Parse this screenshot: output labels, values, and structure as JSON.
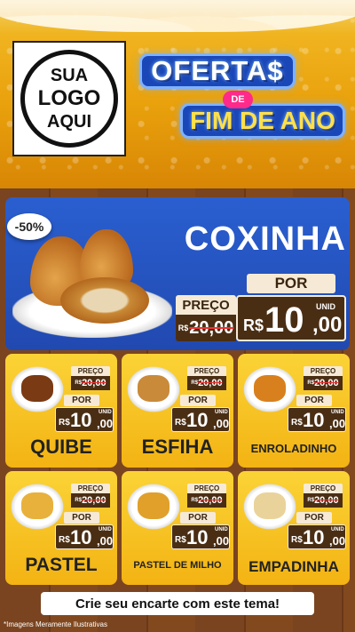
{
  "logo": {
    "line1": "SUA",
    "line2": "LOGO",
    "line3": "AQUI"
  },
  "promo": {
    "line1": "OFERTA$",
    "line2": "DE",
    "line3": "FIM DE ANO"
  },
  "hero": {
    "discount": "-50%",
    "title": "COXINHA",
    "por_label": "POR",
    "preco_label": "PREÇO",
    "old_currency": "R$",
    "old_price": "20,00",
    "new_currency": "R$",
    "new_int": "10",
    "new_cents": ",00",
    "unit": "UNID"
  },
  "products": [
    {
      "name": "QUIBE",
      "preco_label": "PREÇO",
      "old_currency": "R$",
      "old_price": "20,00",
      "por_label": "POR",
      "new_currency": "R$",
      "new_int": "10",
      "new_cents": ",00",
      "unit": "UNID",
      "food_color": "#7a3a14"
    },
    {
      "name": "ESFIHA",
      "preco_label": "PREÇO",
      "old_currency": "R$",
      "old_price": "20,00",
      "por_label": "POR",
      "new_currency": "R$",
      "new_int": "10",
      "new_cents": ",00",
      "unit": "UNID",
      "food_color": "#c98a3a"
    },
    {
      "name": "ENROLADINHO",
      "preco_label": "PREÇO",
      "old_currency": "R$",
      "old_price": "20,00",
      "por_label": "POR",
      "new_currency": "R$",
      "new_int": "10",
      "new_cents": ",00",
      "unit": "UNID",
      "food_color": "#d9801e"
    },
    {
      "name": "PASTEL",
      "preco_label": "PREÇO",
      "old_currency": "R$",
      "old_price": "20,00",
      "por_label": "POR",
      "new_currency": "R$",
      "new_int": "10",
      "new_cents": ",00",
      "unit": "UNID",
      "food_color": "#e8b13c"
    },
    {
      "name": "PASTEL DE MILHO",
      "preco_label": "PREÇO",
      "old_currency": "R$",
      "old_price": "20,00",
      "por_label": "POR",
      "new_currency": "R$",
      "new_int": "10",
      "new_cents": ",00",
      "unit": "UNID",
      "food_color": "#e0a02a"
    },
    {
      "name": "EMPADINHA",
      "preco_label": "PREÇO",
      "old_currency": "R$",
      "old_price": "20,00",
      "por_label": "POR",
      "new_currency": "R$",
      "new_int": "10",
      "new_cents": ",00",
      "unit": "UNID",
      "food_color": "#ead39a"
    }
  ],
  "footer": {
    "cta": "Crie seu encarte com este tema!",
    "disclaimer": "*Imagens Meramente Ilustrativas"
  },
  "colors": {
    "hero_blue": "#2458c6",
    "card_yellow": "#f8c62a",
    "price_brown": "#4a2e14",
    "label_cream": "#f6ead6"
  }
}
